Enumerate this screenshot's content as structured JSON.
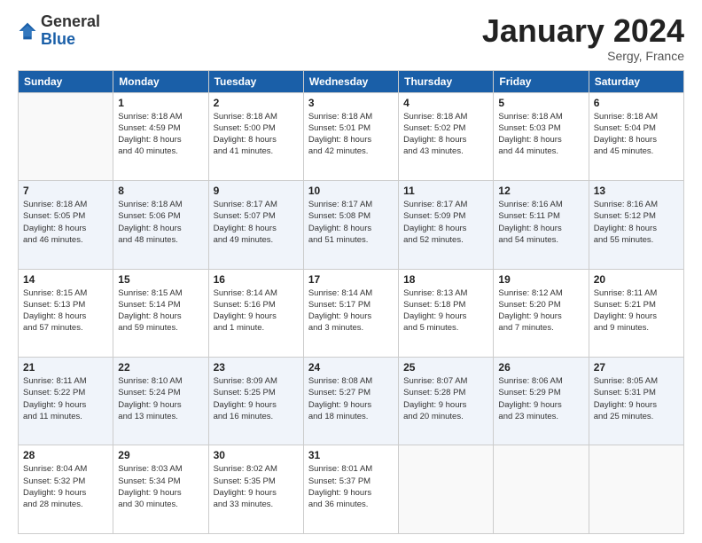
{
  "logo": {
    "general": "General",
    "blue": "Blue"
  },
  "title": "January 2024",
  "location": "Sergy, France",
  "weekdays": [
    "Sunday",
    "Monday",
    "Tuesday",
    "Wednesday",
    "Thursday",
    "Friday",
    "Saturday"
  ],
  "weeks": [
    [
      {
        "day": "",
        "info": ""
      },
      {
        "day": "1",
        "info": "Sunrise: 8:18 AM\nSunset: 4:59 PM\nDaylight: 8 hours\nand 40 minutes."
      },
      {
        "day": "2",
        "info": "Sunrise: 8:18 AM\nSunset: 5:00 PM\nDaylight: 8 hours\nand 41 minutes."
      },
      {
        "day": "3",
        "info": "Sunrise: 8:18 AM\nSunset: 5:01 PM\nDaylight: 8 hours\nand 42 minutes."
      },
      {
        "day": "4",
        "info": "Sunrise: 8:18 AM\nSunset: 5:02 PM\nDaylight: 8 hours\nand 43 minutes."
      },
      {
        "day": "5",
        "info": "Sunrise: 8:18 AM\nSunset: 5:03 PM\nDaylight: 8 hours\nand 44 minutes."
      },
      {
        "day": "6",
        "info": "Sunrise: 8:18 AM\nSunset: 5:04 PM\nDaylight: 8 hours\nand 45 minutes."
      }
    ],
    [
      {
        "day": "7",
        "info": "Sunrise: 8:18 AM\nSunset: 5:05 PM\nDaylight: 8 hours\nand 46 minutes."
      },
      {
        "day": "8",
        "info": "Sunrise: 8:18 AM\nSunset: 5:06 PM\nDaylight: 8 hours\nand 48 minutes."
      },
      {
        "day": "9",
        "info": "Sunrise: 8:17 AM\nSunset: 5:07 PM\nDaylight: 8 hours\nand 49 minutes."
      },
      {
        "day": "10",
        "info": "Sunrise: 8:17 AM\nSunset: 5:08 PM\nDaylight: 8 hours\nand 51 minutes."
      },
      {
        "day": "11",
        "info": "Sunrise: 8:17 AM\nSunset: 5:09 PM\nDaylight: 8 hours\nand 52 minutes."
      },
      {
        "day": "12",
        "info": "Sunrise: 8:16 AM\nSunset: 5:11 PM\nDaylight: 8 hours\nand 54 minutes."
      },
      {
        "day": "13",
        "info": "Sunrise: 8:16 AM\nSunset: 5:12 PM\nDaylight: 8 hours\nand 55 minutes."
      }
    ],
    [
      {
        "day": "14",
        "info": "Sunrise: 8:15 AM\nSunset: 5:13 PM\nDaylight: 8 hours\nand 57 minutes."
      },
      {
        "day": "15",
        "info": "Sunrise: 8:15 AM\nSunset: 5:14 PM\nDaylight: 8 hours\nand 59 minutes."
      },
      {
        "day": "16",
        "info": "Sunrise: 8:14 AM\nSunset: 5:16 PM\nDaylight: 9 hours\nand 1 minute."
      },
      {
        "day": "17",
        "info": "Sunrise: 8:14 AM\nSunset: 5:17 PM\nDaylight: 9 hours\nand 3 minutes."
      },
      {
        "day": "18",
        "info": "Sunrise: 8:13 AM\nSunset: 5:18 PM\nDaylight: 9 hours\nand 5 minutes."
      },
      {
        "day": "19",
        "info": "Sunrise: 8:12 AM\nSunset: 5:20 PM\nDaylight: 9 hours\nand 7 minutes."
      },
      {
        "day": "20",
        "info": "Sunrise: 8:11 AM\nSunset: 5:21 PM\nDaylight: 9 hours\nand 9 minutes."
      }
    ],
    [
      {
        "day": "21",
        "info": "Sunrise: 8:11 AM\nSunset: 5:22 PM\nDaylight: 9 hours\nand 11 minutes."
      },
      {
        "day": "22",
        "info": "Sunrise: 8:10 AM\nSunset: 5:24 PM\nDaylight: 9 hours\nand 13 minutes."
      },
      {
        "day": "23",
        "info": "Sunrise: 8:09 AM\nSunset: 5:25 PM\nDaylight: 9 hours\nand 16 minutes."
      },
      {
        "day": "24",
        "info": "Sunrise: 8:08 AM\nSunset: 5:27 PM\nDaylight: 9 hours\nand 18 minutes."
      },
      {
        "day": "25",
        "info": "Sunrise: 8:07 AM\nSunset: 5:28 PM\nDaylight: 9 hours\nand 20 minutes."
      },
      {
        "day": "26",
        "info": "Sunrise: 8:06 AM\nSunset: 5:29 PM\nDaylight: 9 hours\nand 23 minutes."
      },
      {
        "day": "27",
        "info": "Sunrise: 8:05 AM\nSunset: 5:31 PM\nDaylight: 9 hours\nand 25 minutes."
      }
    ],
    [
      {
        "day": "28",
        "info": "Sunrise: 8:04 AM\nSunset: 5:32 PM\nDaylight: 9 hours\nand 28 minutes."
      },
      {
        "day": "29",
        "info": "Sunrise: 8:03 AM\nSunset: 5:34 PM\nDaylight: 9 hours\nand 30 minutes."
      },
      {
        "day": "30",
        "info": "Sunrise: 8:02 AM\nSunset: 5:35 PM\nDaylight: 9 hours\nand 33 minutes."
      },
      {
        "day": "31",
        "info": "Sunrise: 8:01 AM\nSunset: 5:37 PM\nDaylight: 9 hours\nand 36 minutes."
      },
      {
        "day": "",
        "info": ""
      },
      {
        "day": "",
        "info": ""
      },
      {
        "day": "",
        "info": ""
      }
    ]
  ]
}
